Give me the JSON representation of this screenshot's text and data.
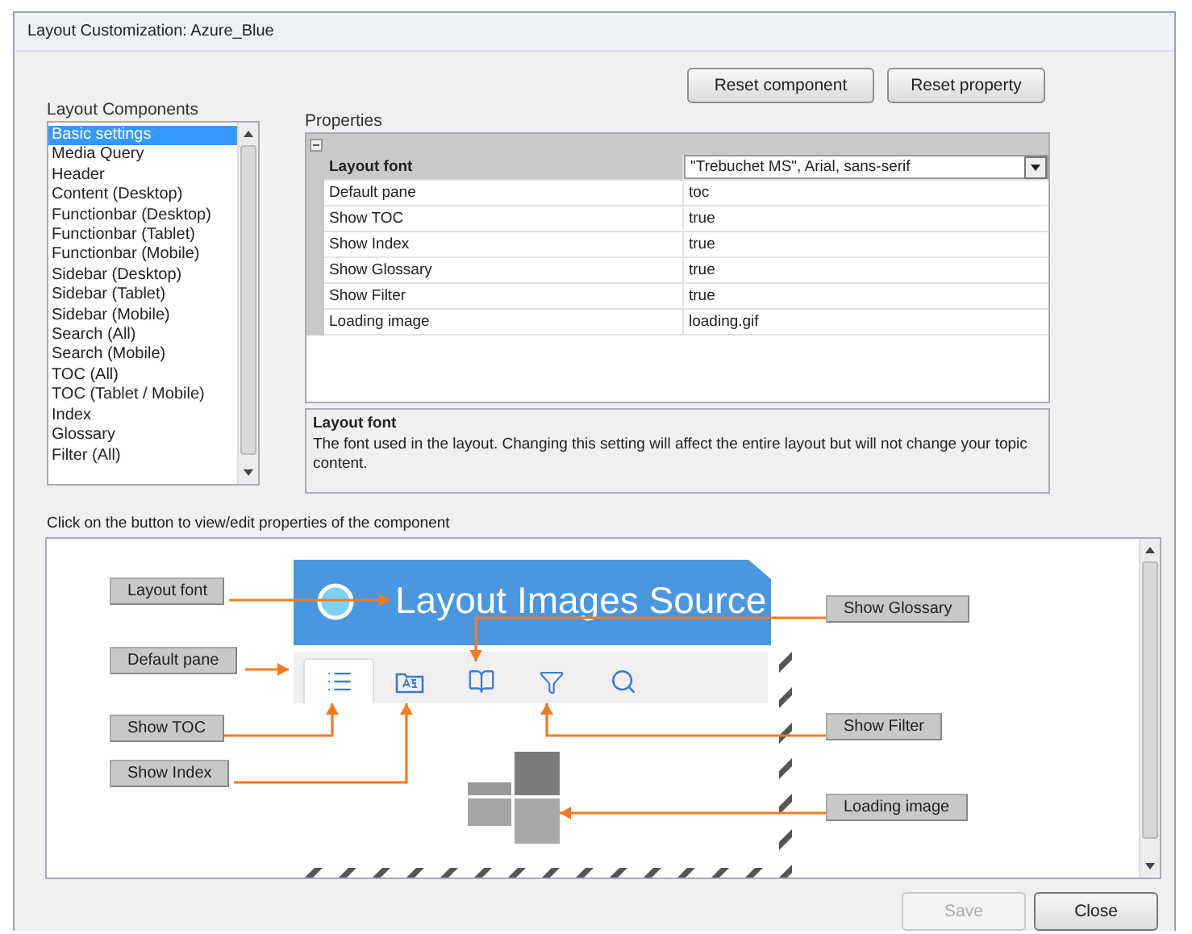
{
  "window": {
    "title": "Layout Customization: Azure_Blue"
  },
  "components": {
    "label": "Layout Components",
    "items": [
      {
        "label": "Basic settings",
        "selected": true
      },
      {
        "label": "Media Query",
        "selected": false
      },
      {
        "label": "Header",
        "selected": false
      },
      {
        "label": "Content (Desktop)",
        "selected": false
      },
      {
        "label": "Functionbar (Desktop)",
        "selected": false
      },
      {
        "label": "Functionbar (Tablet)",
        "selected": false
      },
      {
        "label": "Functionbar (Mobile)",
        "selected": false
      },
      {
        "label": "Sidebar (Desktop)",
        "selected": false
      },
      {
        "label": "Sidebar (Tablet)",
        "selected": false
      },
      {
        "label": "Sidebar (Mobile)",
        "selected": false
      },
      {
        "label": "Search (All)",
        "selected": false
      },
      {
        "label": "Search (Mobile)",
        "selected": false
      },
      {
        "label": "TOC (All)",
        "selected": false
      },
      {
        "label": "TOC (Tablet / Mobile)",
        "selected": false
      },
      {
        "label": "Index",
        "selected": false
      },
      {
        "label": "Glossary",
        "selected": false
      },
      {
        "label": "Filter (All)",
        "selected": false
      }
    ]
  },
  "reset_buttons": [
    "Reset component",
    "Reset property"
  ],
  "properties": {
    "label": "Properties",
    "rows": [
      {
        "name": "Layout font",
        "value": "\"Trebuchet MS\", Arial, sans-serif",
        "selected": true
      },
      {
        "name": "Default pane",
        "value": "toc",
        "selected": false
      },
      {
        "name": "Show TOC",
        "value": "true",
        "selected": false
      },
      {
        "name": "Show Index",
        "value": "true",
        "selected": false
      },
      {
        "name": "Show Glossary",
        "value": "true",
        "selected": false
      },
      {
        "name": "Show Filter",
        "value": "true",
        "selected": false
      },
      {
        "name": "Loading image",
        "value": "loading.gif",
        "selected": false
      }
    ]
  },
  "description": {
    "title": "Layout font",
    "text": "The font used in the layout. Changing this setting will affect the entire layout but will not change your topic content."
  },
  "preview": {
    "caption": "Click on the button to view/edit properties of the component",
    "banner_title": "Layout Images Source",
    "tabs": [
      {
        "kind": "toc",
        "selected": true
      },
      {
        "kind": "index",
        "selected": false
      },
      {
        "kind": "glossary",
        "selected": false
      },
      {
        "kind": "filter",
        "selected": false
      },
      {
        "kind": "search",
        "selected": false
      }
    ],
    "callouts": [
      {
        "label": "Layout font"
      },
      {
        "label": "Default pane"
      },
      {
        "label": "Show TOC"
      },
      {
        "label": "Show Index"
      },
      {
        "label": "Show Glossary"
      },
      {
        "label": "Show Filter"
      },
      {
        "label": "Loading image"
      }
    ]
  },
  "footer_buttons": [
    {
      "label": "Save",
      "disabled": true
    },
    {
      "label": "Close",
      "disabled": false
    }
  ]
}
